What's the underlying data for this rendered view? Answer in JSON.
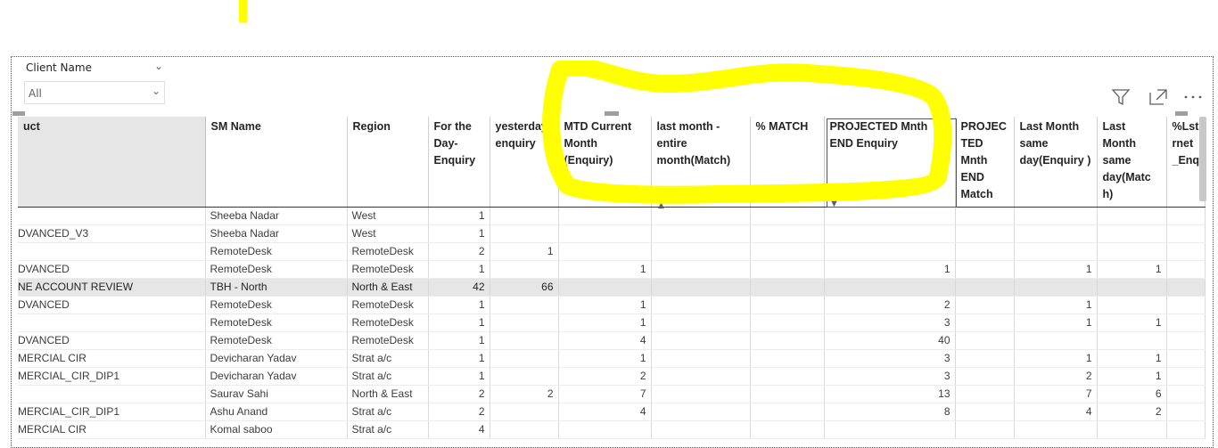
{
  "slicer": {
    "title": "Client Name",
    "value": "All"
  },
  "toolbar": {
    "icons": [
      "filter-icon",
      "focus-mode-icon",
      "more-options-icon"
    ]
  },
  "table": {
    "headers": [
      "uct",
      "SM Name",
      "Region",
      "For the Day-Enquiry",
      "yesterday enquiry",
      "MTD Current Month (Enquiry)",
      "last month - entire month(Match)",
      "% MATCH",
      "PROJECTED Mnth END Enquiry",
      "PROJEC TED Mnth END Match",
      "Last Month same day(Enquiry )",
      "Last Month same day(Matc h)",
      "%Lst rnet _Enq"
    ],
    "rows": [
      [
        "",
        "Sheeba Nadar",
        "West",
        "1",
        "",
        "",
        "",
        "",
        "",
        "",
        "",
        "",
        ""
      ],
      [
        "DVANCED_V3",
        "Sheeba Nadar",
        "West",
        "1",
        "",
        "",
        "",
        "",
        "",
        "",
        "",
        "",
        ""
      ],
      [
        "",
        "RemoteDesk",
        "RemoteDesk",
        "2",
        "1",
        "",
        "",
        "",
        "",
        "",
        "",
        "",
        ""
      ],
      [
        "DVANCED",
        "RemoteDesk",
        "RemoteDesk",
        "1",
        "",
        "1",
        "",
        "",
        "1",
        "",
        "1",
        "1",
        ""
      ],
      [
        "NE ACCOUNT REVIEW",
        "TBH - North",
        "North & East",
        "42",
        "66",
        "",
        "",
        "",
        "",
        "",
        "",
        "",
        ""
      ],
      [
        "DVANCED",
        "RemoteDesk",
        "RemoteDesk",
        "1",
        "",
        "1",
        "",
        "",
        "2",
        "",
        "1",
        "",
        ""
      ],
      [
        "",
        "RemoteDesk",
        "RemoteDesk",
        "1",
        "",
        "1",
        "",
        "",
        "3",
        "",
        "1",
        "1",
        ""
      ],
      [
        "DVANCED",
        "RemoteDesk",
        "RemoteDesk",
        "1",
        "",
        "4",
        "",
        "",
        "40",
        "",
        "",
        "",
        ""
      ],
      [
        "MERCIAL CIR",
        "Devicharan Yadav",
        "Strat a/c",
        "1",
        "",
        "1",
        "",
        "",
        "3",
        "",
        "1",
        "1",
        ""
      ],
      [
        "MERCIAL_CIR_DIP1",
        "Devicharan Yadav",
        "Strat a/c",
        "1",
        "",
        "2",
        "",
        "",
        "3",
        "",
        "2",
        "1",
        ""
      ],
      [
        "",
        "Saurav Sahi",
        "North & East",
        "2",
        "2",
        "7",
        "",
        "",
        "13",
        "",
        "7",
        "6",
        ""
      ],
      [
        "MERCIAL_CIR_DIP1",
        "Ashu Anand",
        "Strat a/c",
        "2",
        "",
        "4",
        "",
        "",
        "8",
        "",
        "4",
        "2",
        ""
      ],
      [
        "MERCIAL CIR",
        "Komal saboo",
        "Strat a/c",
        "4",
        "",
        "",
        "",
        "",
        "",
        "",
        "",
        "",
        ""
      ]
    ],
    "selected_row_index": 4
  },
  "colors": {
    "annotation": "#ffff00",
    "header_first_bg": "#e6e6e6",
    "selected_row_bg": "#e6e6e6"
  }
}
